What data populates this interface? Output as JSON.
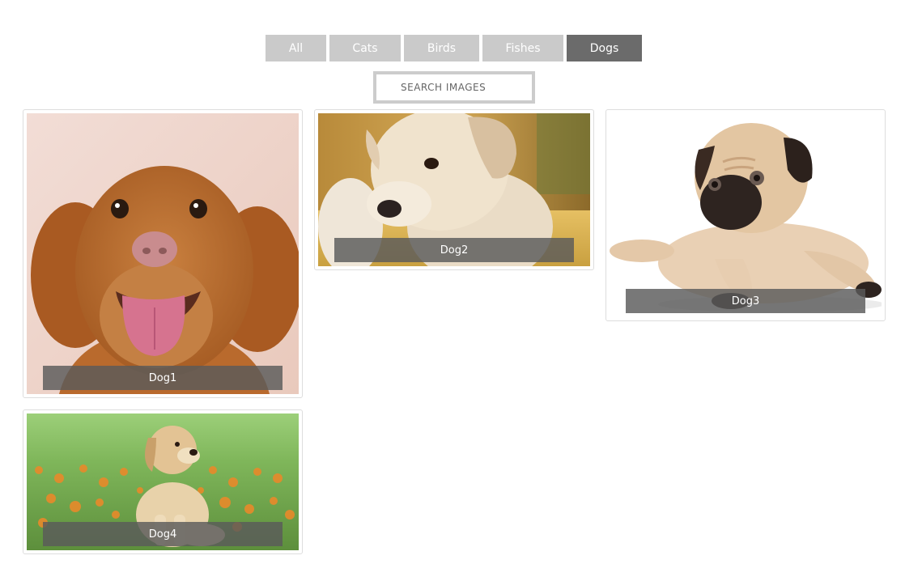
{
  "filters": [
    {
      "label": "All",
      "active": false
    },
    {
      "label": "Cats",
      "active": false
    },
    {
      "label": "Birds",
      "active": false
    },
    {
      "label": "Fishes",
      "active": false
    },
    {
      "label": "Dogs",
      "active": true
    }
  ],
  "search": {
    "placeholder": "SEARCH IMAGES",
    "value": ""
  },
  "gallery": {
    "items": [
      {
        "caption": "Dog1"
      },
      {
        "caption": "Dog2"
      },
      {
        "caption": "Dog3"
      },
      {
        "caption": "Dog4"
      }
    ]
  },
  "colors": {
    "filter_inactive": "#cacaca",
    "filter_active": "#6b6b6b",
    "caption_bg": "#5a5a5a",
    "search_border": "#cccccc"
  }
}
